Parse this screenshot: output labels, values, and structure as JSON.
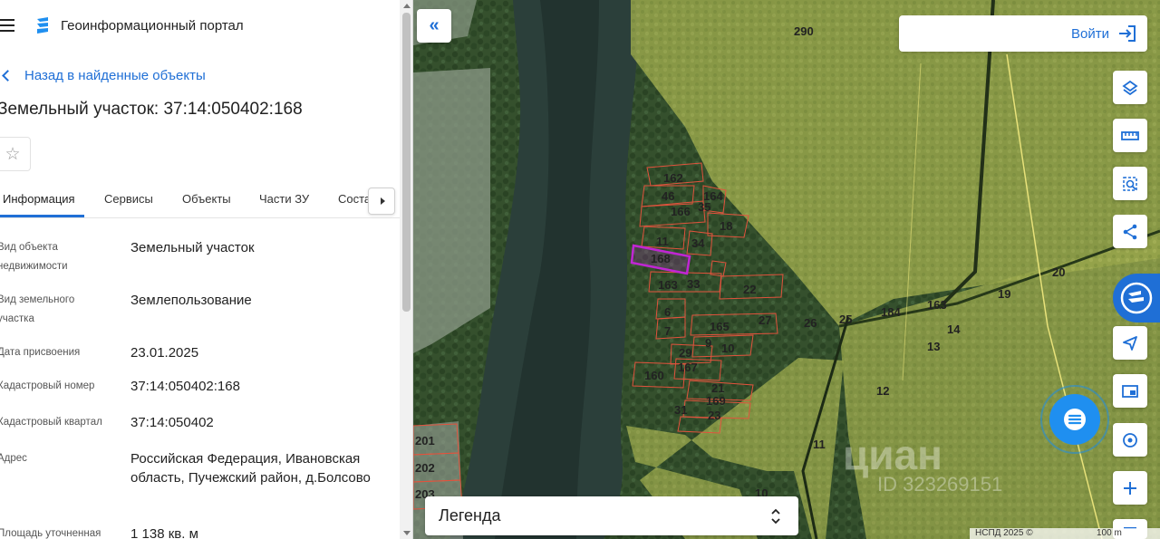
{
  "header": {
    "portal_title": "Геоинформационный портал"
  },
  "nav": {
    "back_label": "Назад в найденные объекты"
  },
  "object": {
    "title": "Земельный участок: 37:14:050402:168"
  },
  "tabs": [
    {
      "label": "Информация",
      "active": true
    },
    {
      "label": "Сервисы"
    },
    {
      "label": "Объекты"
    },
    {
      "label": "Части ЗУ"
    },
    {
      "label": "Соста"
    }
  ],
  "properties": [
    {
      "label": "Вид объекта недвижимости",
      "value": "Земельный участок"
    },
    {
      "label": "Вид земельного участка",
      "value": "Землепользование"
    },
    {
      "label": "Дата присвоения",
      "value": "23.01.2025"
    },
    {
      "label": "Кадастровый номер",
      "value": "37:14:050402:168"
    },
    {
      "label": "Кадастровый квартал",
      "value": "37:14:050402"
    },
    {
      "label": "Адрес",
      "value": "Российская Федерация, Ивановская область, Пучежский район, д.Болсово"
    },
    {
      "label": "Площадь уточненная",
      "value": "1 138 кв. м"
    }
  ],
  "map": {
    "login_label": "Войти",
    "legend_label": "Легенда",
    "attribution": "НСПД 2025 ©",
    "scale_label": "100 m",
    "watermark_text": "циан",
    "watermark_id": "ID 323269151",
    "selected_parcel_color": "#c026d3",
    "parcel_labels": [
      "290",
      "162",
      "46",
      "164",
      "35",
      "166",
      "18",
      "11",
      "34",
      "168",
      "163",
      "33",
      "22",
      "6",
      "165",
      "27",
      "26",
      "25",
      "184",
      "163",
      "19",
      "20",
      "7",
      "9",
      "10",
      "29",
      "167",
      "160",
      "21",
      "169",
      "31",
      "23",
      "14",
      "13",
      "12",
      "11",
      "201",
      "202",
      "203",
      "10"
    ],
    "tools": [
      "layers-icon",
      "ruler-icon",
      "area-select-icon",
      "share-icon",
      "navigate-icon",
      "minimap-icon",
      "geolocate-icon",
      "zoom-in-icon"
    ]
  },
  "colors": {
    "accent": "#1f6fd6",
    "parcel_fill": "#d7d96a",
    "parcel_outline": "#e2533d"
  }
}
